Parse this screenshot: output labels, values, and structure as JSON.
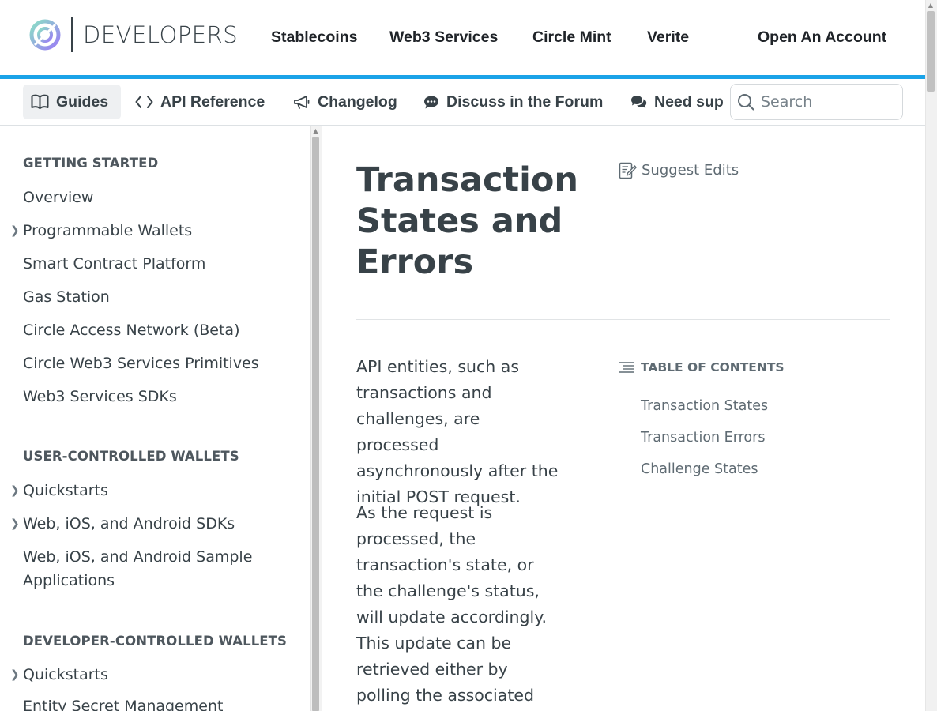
{
  "brand": {
    "logo_text": "DEVELOPERS",
    "colors": {
      "accent_bar": "#1aa3e8",
      "logo_gradient_start": "#8be0c5",
      "logo_gradient_end": "#9b7cf5"
    }
  },
  "top_nav": {
    "items": [
      "Stablecoins",
      "Web3 Services",
      "Circle Mint",
      "Verite"
    ],
    "cta": "Open An Account"
  },
  "sub_nav": {
    "items": [
      {
        "label": "Guides",
        "icon": "book-icon",
        "active": true
      },
      {
        "label": "API Reference",
        "icon": "code-icon"
      },
      {
        "label": "Changelog",
        "icon": "megaphone-icon"
      },
      {
        "label": "Discuss in the Forum",
        "icon": "chat-bubble-icon"
      },
      {
        "label": "Need support?",
        "visible_text": "Need sup",
        "icon": "chat-bubbles-icon"
      }
    ],
    "search_placeholder": "Search"
  },
  "sidebar": {
    "sections": [
      {
        "heading": "GETTING STARTED",
        "items": [
          {
            "label": "Overview",
            "expandable": false
          },
          {
            "label": "Programmable Wallets",
            "expandable": true
          },
          {
            "label": "Smart Contract Platform",
            "expandable": false
          },
          {
            "label": "Gas Station",
            "expandable": false
          },
          {
            "label": "Circle Access Network (Beta)",
            "expandable": false
          },
          {
            "label": "Circle Web3 Services Primitives",
            "expandable": false
          },
          {
            "label": "Web3 Services SDKs",
            "expandable": false
          }
        ]
      },
      {
        "heading": "USER-CONTROLLED WALLETS",
        "items": [
          {
            "label": "Quickstarts",
            "expandable": true
          },
          {
            "label": "Web, iOS, and Android SDKs",
            "expandable": true
          },
          {
            "label": "Web, iOS, and Android Sample Applications",
            "expandable": false
          }
        ]
      },
      {
        "heading": "DEVELOPER-CONTROLLED WALLETS",
        "items": [
          {
            "label": "Quickstarts",
            "expandable": true
          },
          {
            "label": "Entity Secret Management",
            "expandable": false
          }
        ]
      }
    ]
  },
  "main": {
    "title": "Transaction States and Errors",
    "suggest_edits": "Suggest Edits",
    "paragraphs": [
      "API entities, such as transactions and challenges, are processed asynchronously after the initial POST request.",
      "As the request is processed, the transaction's state, or the challenge's status, will update accordingly. This update can be retrieved either by polling the associated GET endpoint"
    ],
    "toc": {
      "heading": "TABLE OF CONTENTS",
      "links": [
        "Transaction States",
        "Transaction Errors",
        "Challenge States"
      ]
    }
  }
}
